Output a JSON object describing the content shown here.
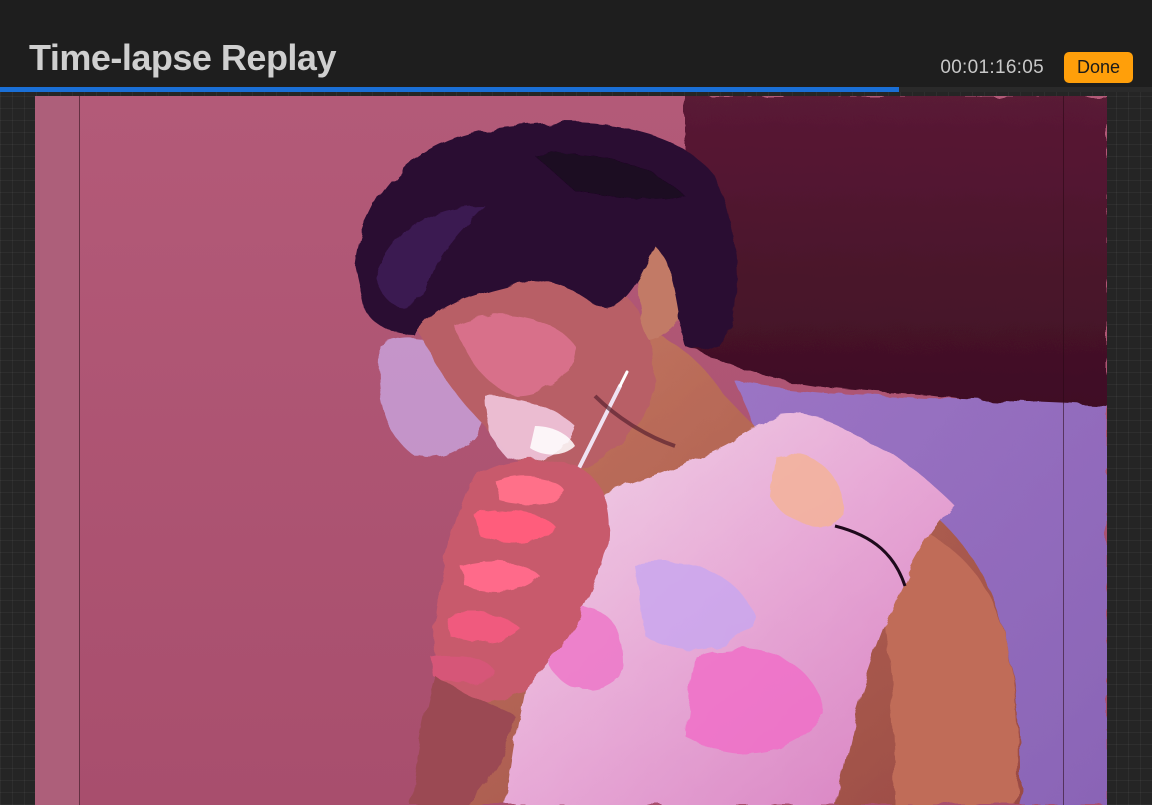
{
  "header": {
    "title": "Time-lapse Replay",
    "timecode": "00:01:16:05",
    "done_label": "Done"
  },
  "playback": {
    "progress": 0.78
  },
  "colors": {
    "accent_blue": "#1a6fd6",
    "done_orange": "#ff9f0a",
    "background": "#1e1e1e"
  },
  "canvas": {
    "subject": "digital painting in progress"
  }
}
